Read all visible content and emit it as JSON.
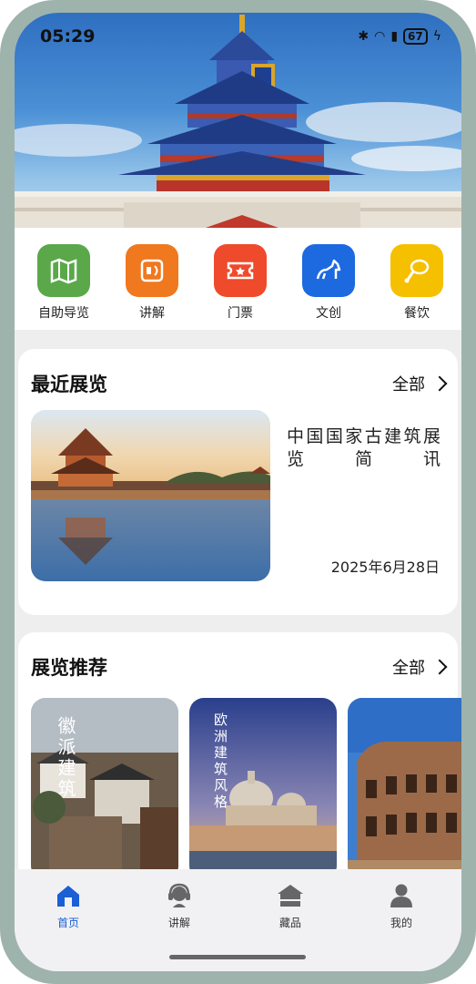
{
  "status": {
    "time": "05:29",
    "battery": "67"
  },
  "quick_actions": [
    {
      "label": "自助导览",
      "icon": "map-icon",
      "color": "#5aa84a"
    },
    {
      "label": "讲解",
      "icon": "audio-guide-icon",
      "color": "#f0781e"
    },
    {
      "label": "门票",
      "icon": "ticket-icon",
      "color": "#ee4a2b"
    },
    {
      "label": "文创",
      "icon": "creative-horse-icon",
      "color": "#1d69e0"
    },
    {
      "label": "餐饮",
      "icon": "food-icon",
      "color": "#f5c000"
    }
  ],
  "recent": {
    "title": "最近展览",
    "more": "全部",
    "item": {
      "name": "中国国家古建筑展览简讯",
      "date": "2025年6月28日"
    }
  },
  "recommend": {
    "title": "展览推荐",
    "more": "全部",
    "items": [
      {
        "label": "徽派建筑"
      },
      {
        "label": "欧洲建筑风格"
      },
      {
        "label": ""
      }
    ]
  },
  "nav": [
    {
      "label": "首页",
      "icon": "home-icon",
      "active": true
    },
    {
      "label": "讲解",
      "icon": "headset-icon",
      "active": false
    },
    {
      "label": "藏品",
      "icon": "collection-icon",
      "active": false
    },
    {
      "label": "我的",
      "icon": "profile-icon",
      "active": false
    }
  ],
  "colors": {
    "accent": "#1a5fd6"
  }
}
